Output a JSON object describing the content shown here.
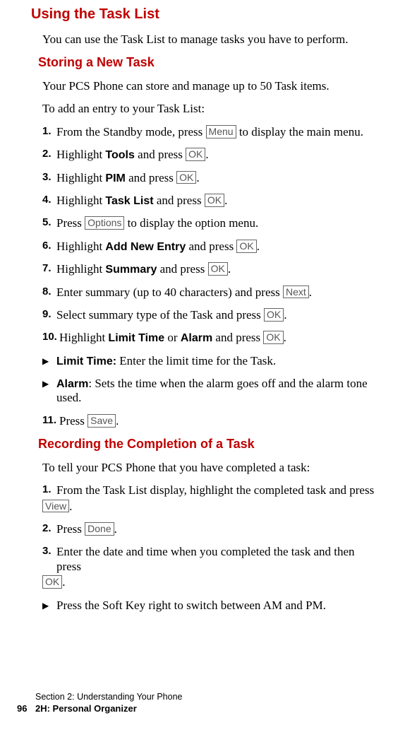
{
  "h1": "Using the Task List",
  "intro1": "You can use the Task List to manage tasks you have to perform.",
  "h2a": "Storing a New Task",
  "intro2": "Your PCS Phone can store and manage up to 50 Task items.",
  "intro3": "To add an entry to your Task List:",
  "s1": {
    "n": "1.",
    "pre": "From the Standby mode, press ",
    "key": "Menu",
    "post": " to display the main menu."
  },
  "s2": {
    "n": "2.",
    "pre": "Highlight ",
    "bold": "Tools",
    "mid": " and press ",
    "key": "OK",
    "post": "."
  },
  "s3": {
    "n": "3.",
    "pre": "Highlight ",
    "bold": "PIM",
    "mid": " and press ",
    "key": "OK",
    "post": "."
  },
  "s4": {
    "n": "4.",
    "pre": "Highlight ",
    "bold": "Task List",
    "mid": " and press ",
    "key": "OK",
    "post": "."
  },
  "s5": {
    "n": "5.",
    "pre": "Press ",
    "key": "Options",
    "post": " to display the option menu."
  },
  "s6": {
    "n": "6.",
    "pre": "Highlight ",
    "bold": "Add New Entry",
    "mid": " and press ",
    "key": "OK",
    "post": "."
  },
  "s7": {
    "n": "7.",
    "pre": "Highlight ",
    "bold": "Summary",
    "mid": " and press ",
    "key": "OK",
    "post": "."
  },
  "s8": {
    "n": "8.",
    "pre": "Enter summary (up to 40 characters) and press ",
    "key": "Next",
    "post": "."
  },
  "s9": {
    "n": "9.",
    "pre": "Select summary type of the Task and press ",
    "key": "OK",
    "post": "."
  },
  "s10": {
    "n": "10.",
    "pre": "Highlight ",
    "bold1": "Limit Time",
    "mid1": " or ",
    "bold2": "Alarm",
    "mid2": " and press ",
    "key": "OK",
    "post": "."
  },
  "b1": {
    "bold": "Limit Time:",
    "text": " Enter the limit time for the Task."
  },
  "b2": {
    "bold": "Alarm",
    "text": ": Sets the time when the alarm goes off and the alarm tone used."
  },
  "s11": {
    "n": "11.",
    "pre": "Press ",
    "key": "Save",
    "post": "."
  },
  "h2b": "Recording the Completion of a Task",
  "intro4": "To tell your PCS Phone that you have completed a task:",
  "r1": {
    "n": "1.",
    "pre": "From the Task List display, highlight the completed task and press ",
    "key": "View",
    "post": "."
  },
  "r2": {
    "n": "2.",
    "pre": "Press ",
    "key": "Done",
    "post": "."
  },
  "r3": {
    "n": "3.",
    "pre": "Enter the date and time when you completed the task and then press ",
    "key": "OK",
    "post": "."
  },
  "b3": {
    "text": "Press the Soft Key right to switch between AM and PM."
  },
  "ftr": {
    "l1": "Section 2: Understanding Your Phone",
    "pn": "96",
    "l2": "2H: Personal Organizer"
  }
}
